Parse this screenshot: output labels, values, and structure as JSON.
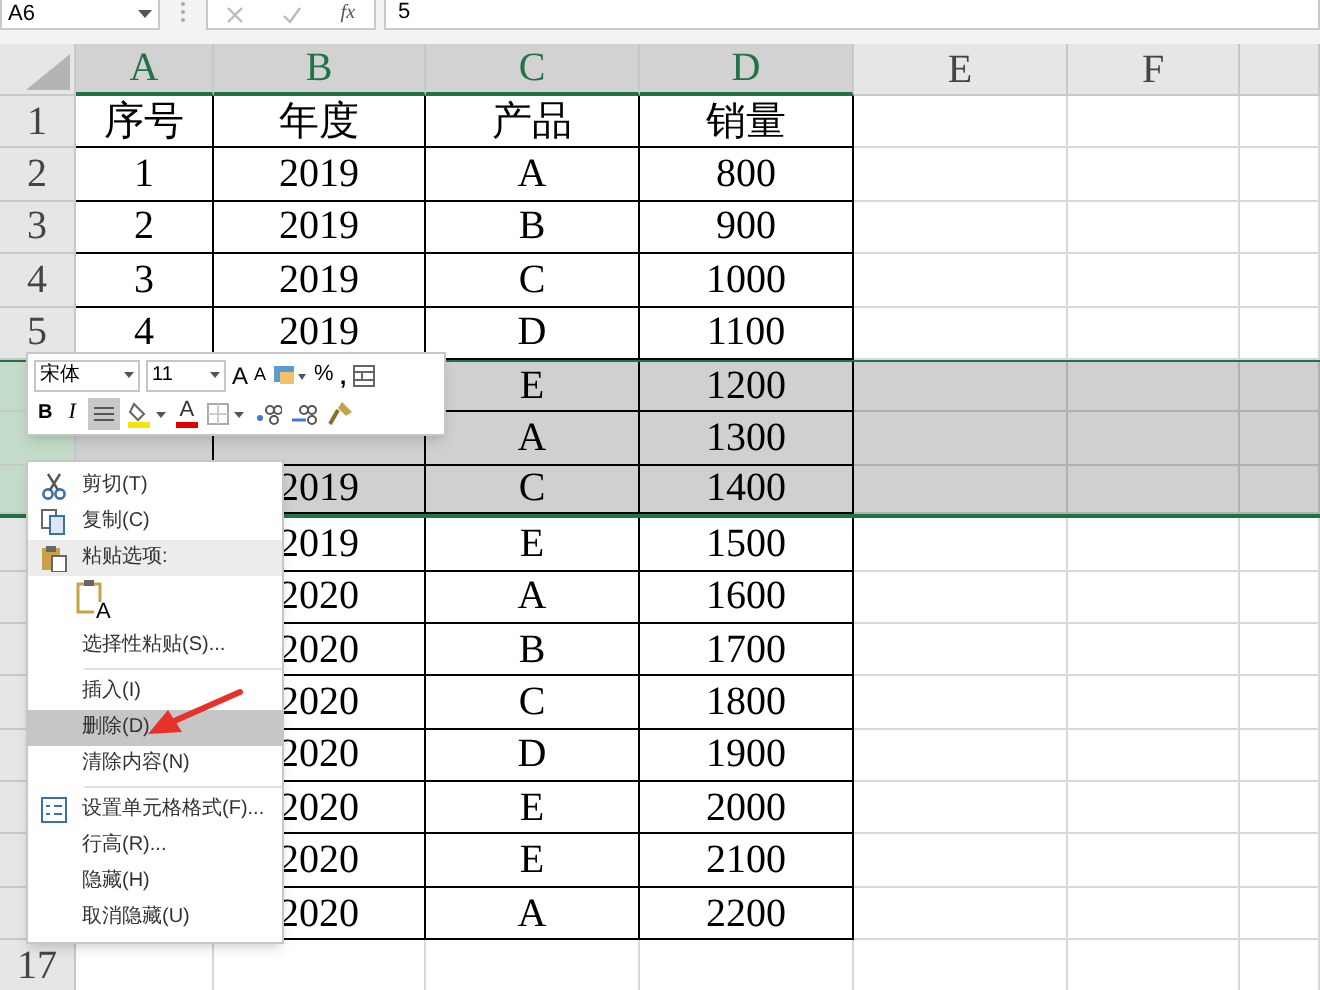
{
  "formula_bar": {
    "name_box": "A6",
    "function_label": "fx",
    "value": "5"
  },
  "columns": [
    {
      "label": "A",
      "highlighted": true
    },
    {
      "label": "B",
      "highlighted": true
    },
    {
      "label": "C",
      "highlighted": true
    },
    {
      "label": "D",
      "highlighted": true
    },
    {
      "label": "E",
      "highlighted": false
    },
    {
      "label": "F",
      "highlighted": false
    },
    {
      "highlighted": false
    }
  ],
  "rows": [
    {
      "header": "1",
      "selected": false,
      "cells": [
        "序号",
        "年度",
        "产品",
        "销量"
      ]
    },
    {
      "header": "2",
      "selected": false,
      "cells": [
        "1",
        "2019",
        "A",
        "800"
      ]
    },
    {
      "header": "3",
      "selected": false,
      "cells": [
        "2",
        "2019",
        "B",
        "900"
      ]
    },
    {
      "header": "4",
      "selected": false,
      "cells": [
        "3",
        "2019",
        "C",
        "1000"
      ]
    },
    {
      "header": "5",
      "selected": false,
      "cells": [
        "4",
        "2019",
        "D",
        "1100"
      ]
    },
    {
      "header": null,
      "selected": true,
      "cells": [
        null,
        null,
        "E",
        "1200"
      ]
    },
    {
      "header": null,
      "selected": true,
      "cells": [
        null,
        null,
        "A",
        "1300"
      ]
    },
    {
      "header": null,
      "selected": true,
      "cells": [
        null,
        "2019",
        "C",
        "1400"
      ]
    },
    {
      "header": null,
      "selected": false,
      "cells": [
        null,
        "2019",
        "E",
        "1500"
      ]
    },
    {
      "header": null,
      "selected": false,
      "cells": [
        null,
        "2020",
        "A",
        "1600"
      ]
    },
    {
      "header": null,
      "selected": false,
      "cells": [
        null,
        "2020",
        "B",
        "1700"
      ]
    },
    {
      "header": null,
      "selected": false,
      "cells": [
        null,
        "2020",
        "C",
        "1800"
      ]
    },
    {
      "header": null,
      "selected": false,
      "cells": [
        null,
        "2020",
        "D",
        "1900"
      ]
    },
    {
      "header": null,
      "selected": false,
      "cells": [
        null,
        "2020",
        "E",
        "2000"
      ]
    },
    {
      "header": null,
      "selected": false,
      "cells": [
        null,
        "2020",
        "E",
        "2100"
      ]
    },
    {
      "header": null,
      "selected": false,
      "cells": [
        null,
        "2020",
        "A",
        "2200"
      ]
    },
    {
      "header": "17",
      "selected": false,
      "cells": [
        null,
        null,
        null,
        null
      ]
    }
  ],
  "mini_toolbar": {
    "font": "宋体",
    "size": "11",
    "grow_label": "A",
    "shrink_label": "A",
    "percent": "%",
    "comma": ",",
    "bold": "B",
    "italic": "I",
    "align_selected": true,
    "font_color_label": "A"
  },
  "context_menu": [
    {
      "kind": "cut",
      "label": "剪切(T)",
      "highlighted": false
    },
    {
      "kind": "copy",
      "label": "复制(C)",
      "highlighted": false
    },
    {
      "kind": "paste-header",
      "label": "粘贴选项:",
      "highlighted": false
    },
    {
      "kind": "paste-option",
      "label": "A"
    },
    {
      "kind": "plain",
      "label": "选择性粘贴(S)...",
      "highlighted": false
    },
    {
      "kind": "separator"
    },
    {
      "kind": "plain",
      "label": "插入(I)",
      "highlighted": false
    },
    {
      "kind": "plain",
      "label": "删除(D)",
      "highlighted": true
    },
    {
      "kind": "plain",
      "label": "清除内容(N)",
      "highlighted": false
    },
    {
      "kind": "separator"
    },
    {
      "kind": "format",
      "label": "设置单元格格式(F)...",
      "highlighted": false
    },
    {
      "kind": "plain",
      "label": "行高(R)...",
      "highlighted": false
    },
    {
      "kind": "plain",
      "label": "隐藏(H)",
      "highlighted": false
    },
    {
      "kind": "plain",
      "label": "取消隐藏(U)",
      "highlighted": false
    }
  ],
  "annotation": {
    "kind": "arrow"
  }
}
